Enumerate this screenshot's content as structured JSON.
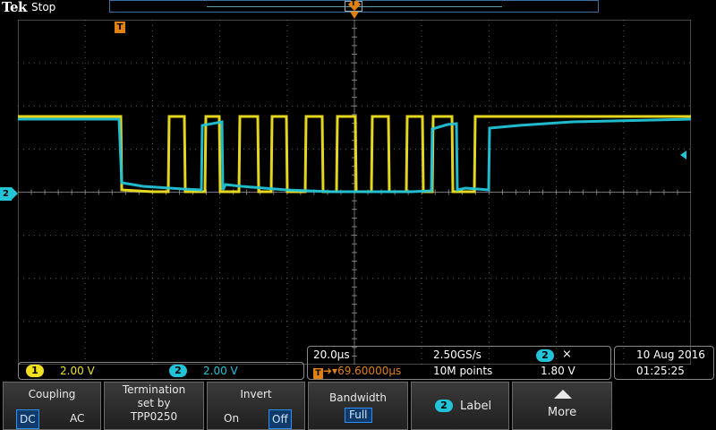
{
  "header": {
    "brand": "Tek",
    "run_state": "Stop",
    "trigger_position_label": "T"
  },
  "graticule": {
    "trigger_marker_label": "T",
    "ch2_marker_label": "2",
    "colors": {
      "ch1": "#f0e020",
      "ch2": "#22c4d8",
      "trigger": "#e08010",
      "grid": "#9a9a9a"
    }
  },
  "channels": {
    "ch1": {
      "badge": "1",
      "scale": "2.00 V"
    },
    "ch2": {
      "badge": "2",
      "scale": "2.00 V"
    }
  },
  "acquisition": {
    "horizontal_scale": "20.0µs",
    "sample_rate": "2.50GS/s",
    "record_length": "10M points",
    "trigger_delay": "69.60000µs",
    "trigger_delay_prefix": "T",
    "trigger_source": "2",
    "trigger_slope": "⨯",
    "trigger_level": "1.80 V"
  },
  "datetime": {
    "date": "10 Aug 2016",
    "time": "01:25:25"
  },
  "menu": {
    "coupling": {
      "title": "Coupling",
      "opt_dc": "DC",
      "opt_ac": "AC"
    },
    "termination": {
      "line1": "Termination",
      "line2": "set by",
      "line3": "TPP0250"
    },
    "invert": {
      "title": "Invert",
      "opt_on": "On",
      "opt_off": "Off"
    },
    "bandwidth": {
      "title": "Bandwidth",
      "value": "Full"
    },
    "label": {
      "badge": "2",
      "text": "Label"
    },
    "more": {
      "text": "More"
    }
  }
}
